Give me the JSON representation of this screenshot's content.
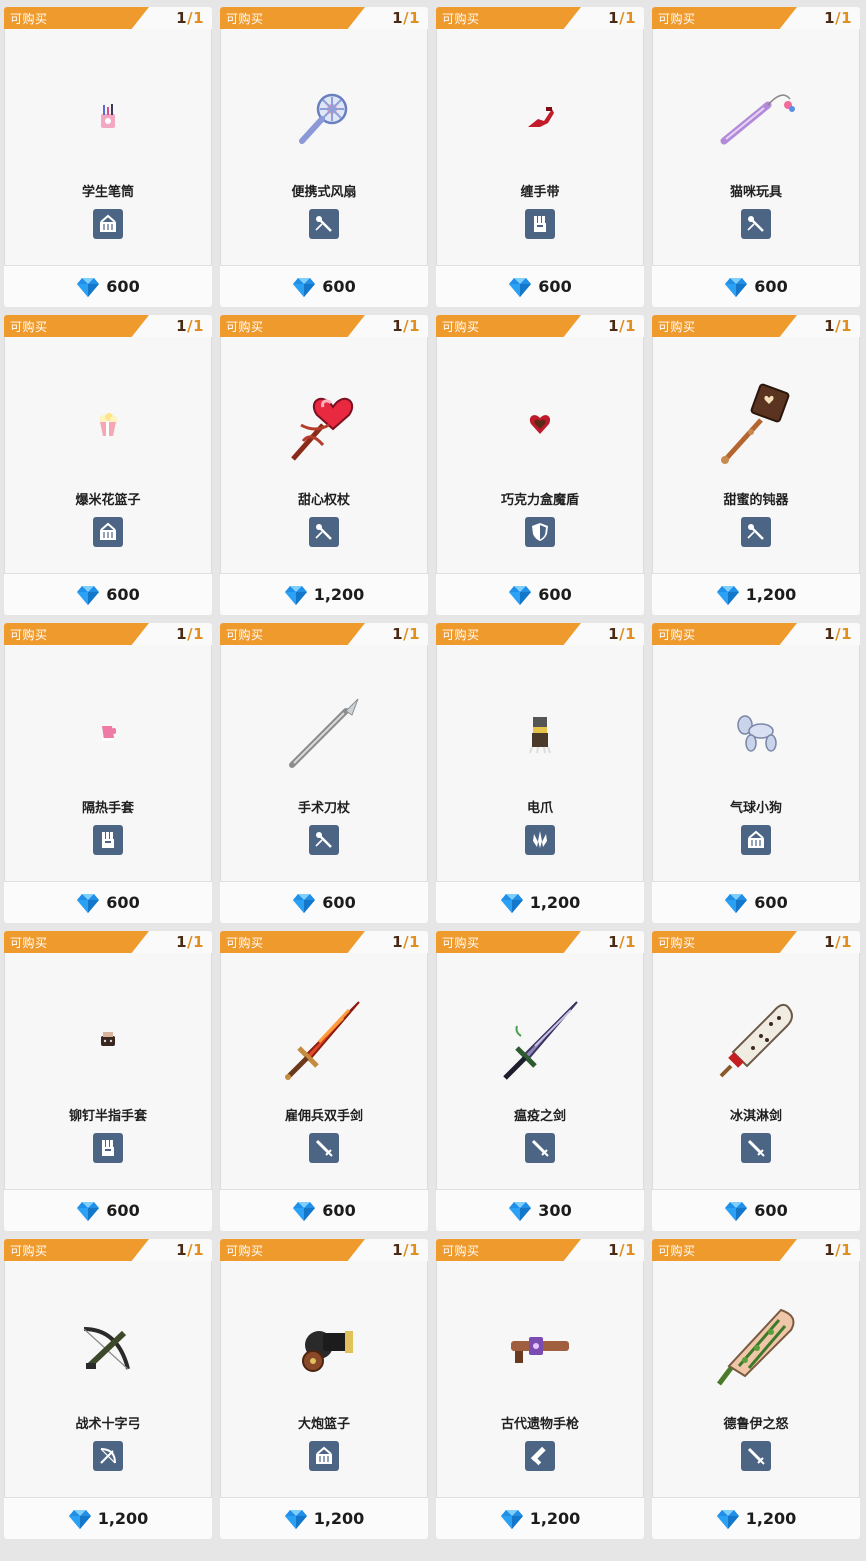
{
  "status_label": "可购买",
  "items": [
    {
      "name": "学生笔筒",
      "price": "600",
      "count_cur": "1",
      "count_max": "1",
      "category_icon": "basket-icon",
      "item_icon": "pencil-cup-icon"
    },
    {
      "name": "便携式风扇",
      "price": "600",
      "count_cur": "1",
      "count_max": "1",
      "category_icon": "wand-icon",
      "item_icon": "fan-icon"
    },
    {
      "name": "缠手带",
      "price": "600",
      "count_cur": "1",
      "count_max": "1",
      "category_icon": "fist-icon",
      "item_icon": "hand-wrap-icon"
    },
    {
      "name": "猫咪玩具",
      "price": "600",
      "count_cur": "1",
      "count_max": "1",
      "category_icon": "wand-icon",
      "item_icon": "cat-toy-icon"
    },
    {
      "name": "爆米花篮子",
      "price": "600",
      "count_cur": "1",
      "count_max": "1",
      "category_icon": "basket-icon",
      "item_icon": "popcorn-icon"
    },
    {
      "name": "甜心权杖",
      "price": "1,200",
      "count_cur": "1",
      "count_max": "1",
      "category_icon": "wand-icon",
      "item_icon": "heart-scepter-icon"
    },
    {
      "name": "巧克力盒魔盾",
      "price": "600",
      "count_cur": "1",
      "count_max": "1",
      "category_icon": "shield-icon",
      "item_icon": "chocolate-heart-icon"
    },
    {
      "name": "甜蜜的钝器",
      "price": "1,200",
      "count_cur": "1",
      "count_max": "1",
      "category_icon": "wand-icon",
      "item_icon": "chocolate-mace-icon"
    },
    {
      "name": "隔热手套",
      "price": "600",
      "count_cur": "1",
      "count_max": "1",
      "category_icon": "fist-icon",
      "item_icon": "oven-mitt-icon"
    },
    {
      "name": "手术刀杖",
      "price": "600",
      "count_cur": "1",
      "count_max": "1",
      "category_icon": "wand-icon",
      "item_icon": "scalpel-icon"
    },
    {
      "name": "电爪",
      "price": "1,200",
      "count_cur": "1",
      "count_max": "1",
      "category_icon": "claw-icon",
      "item_icon": "electric-claw-icon"
    },
    {
      "name": "气球小狗",
      "price": "600",
      "count_cur": "1",
      "count_max": "1",
      "category_icon": "basket-icon",
      "item_icon": "balloon-dog-icon"
    },
    {
      "name": "铆钉半指手套",
      "price": "600",
      "count_cur": "1",
      "count_max": "1",
      "category_icon": "fist-icon",
      "item_icon": "studded-glove-icon"
    },
    {
      "name": "雇佣兵双手剑",
      "price": "600",
      "count_cur": "1",
      "count_max": "1",
      "category_icon": "sword-icon",
      "item_icon": "flame-sword-icon"
    },
    {
      "name": "瘟疫之剑",
      "price": "300",
      "count_cur": "1",
      "count_max": "1",
      "category_icon": "sword-icon",
      "item_icon": "plague-sword-icon"
    },
    {
      "name": "冰淇淋剑",
      "price": "600",
      "count_cur": "1",
      "count_max": "1",
      "category_icon": "sword-icon",
      "item_icon": "ice-cream-sword-icon"
    },
    {
      "name": "战术十字弓",
      "price": "1,200",
      "count_cur": "1",
      "count_max": "1",
      "category_icon": "bow-icon",
      "item_icon": "crossbow-icon"
    },
    {
      "name": "大炮篮子",
      "price": "1,200",
      "count_cur": "1",
      "count_max": "1",
      "category_icon": "basket-icon",
      "item_icon": "cannon-icon"
    },
    {
      "name": "古代遗物手枪",
      "price": "1,200",
      "count_cur": "1",
      "count_max": "1",
      "category_icon": "gun-icon",
      "item_icon": "relic-pistol-icon"
    },
    {
      "name": "德鲁伊之怒",
      "price": "1,200",
      "count_cur": "1",
      "count_max": "1",
      "category_icon": "sword-icon",
      "item_icon": "druid-blade-icon"
    }
  ],
  "colors": {
    "tag": "#ef9a2d",
    "category_bg": "#4d6584",
    "gem": "#1f8fe8"
  }
}
